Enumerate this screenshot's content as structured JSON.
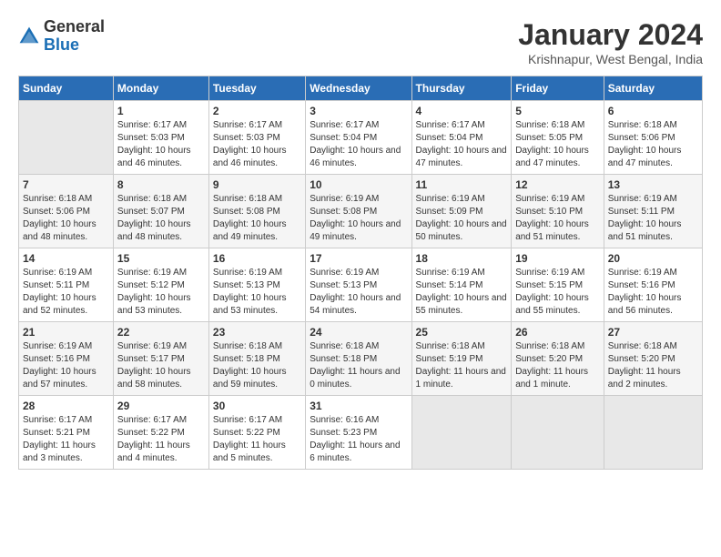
{
  "header": {
    "logo": {
      "general": "General",
      "blue": "Blue"
    },
    "title": "January 2024",
    "location": "Krishnapur, West Bengal, India"
  },
  "columns": [
    "Sunday",
    "Monday",
    "Tuesday",
    "Wednesday",
    "Thursday",
    "Friday",
    "Saturday"
  ],
  "weeks": [
    [
      {
        "day": "",
        "empty": true
      },
      {
        "day": "1",
        "sunrise": "6:17 AM",
        "sunset": "5:03 PM",
        "daylight": "10 hours and 46 minutes."
      },
      {
        "day": "2",
        "sunrise": "6:17 AM",
        "sunset": "5:03 PM",
        "daylight": "10 hours and 46 minutes."
      },
      {
        "day": "3",
        "sunrise": "6:17 AM",
        "sunset": "5:04 PM",
        "daylight": "10 hours and 46 minutes."
      },
      {
        "day": "4",
        "sunrise": "6:17 AM",
        "sunset": "5:04 PM",
        "daylight": "10 hours and 47 minutes."
      },
      {
        "day": "5",
        "sunrise": "6:18 AM",
        "sunset": "5:05 PM",
        "daylight": "10 hours and 47 minutes."
      },
      {
        "day": "6",
        "sunrise": "6:18 AM",
        "sunset": "5:06 PM",
        "daylight": "10 hours and 47 minutes."
      }
    ],
    [
      {
        "day": "7",
        "sunrise": "6:18 AM",
        "sunset": "5:06 PM",
        "daylight": "10 hours and 48 minutes."
      },
      {
        "day": "8",
        "sunrise": "6:18 AM",
        "sunset": "5:07 PM",
        "daylight": "10 hours and 48 minutes."
      },
      {
        "day": "9",
        "sunrise": "6:18 AM",
        "sunset": "5:08 PM",
        "daylight": "10 hours and 49 minutes."
      },
      {
        "day": "10",
        "sunrise": "6:19 AM",
        "sunset": "5:08 PM",
        "daylight": "10 hours and 49 minutes."
      },
      {
        "day": "11",
        "sunrise": "6:19 AM",
        "sunset": "5:09 PM",
        "daylight": "10 hours and 50 minutes."
      },
      {
        "day": "12",
        "sunrise": "6:19 AM",
        "sunset": "5:10 PM",
        "daylight": "10 hours and 51 minutes."
      },
      {
        "day": "13",
        "sunrise": "6:19 AM",
        "sunset": "5:11 PM",
        "daylight": "10 hours and 51 minutes."
      }
    ],
    [
      {
        "day": "14",
        "sunrise": "6:19 AM",
        "sunset": "5:11 PM",
        "daylight": "10 hours and 52 minutes."
      },
      {
        "day": "15",
        "sunrise": "6:19 AM",
        "sunset": "5:12 PM",
        "daylight": "10 hours and 53 minutes."
      },
      {
        "day": "16",
        "sunrise": "6:19 AM",
        "sunset": "5:13 PM",
        "daylight": "10 hours and 53 minutes."
      },
      {
        "day": "17",
        "sunrise": "6:19 AM",
        "sunset": "5:13 PM",
        "daylight": "10 hours and 54 minutes."
      },
      {
        "day": "18",
        "sunrise": "6:19 AM",
        "sunset": "5:14 PM",
        "daylight": "10 hours and 55 minutes."
      },
      {
        "day": "19",
        "sunrise": "6:19 AM",
        "sunset": "5:15 PM",
        "daylight": "10 hours and 55 minutes."
      },
      {
        "day": "20",
        "sunrise": "6:19 AM",
        "sunset": "5:16 PM",
        "daylight": "10 hours and 56 minutes."
      }
    ],
    [
      {
        "day": "21",
        "sunrise": "6:19 AM",
        "sunset": "5:16 PM",
        "daylight": "10 hours and 57 minutes."
      },
      {
        "day": "22",
        "sunrise": "6:19 AM",
        "sunset": "5:17 PM",
        "daylight": "10 hours and 58 minutes."
      },
      {
        "day": "23",
        "sunrise": "6:18 AM",
        "sunset": "5:18 PM",
        "daylight": "10 hours and 59 minutes."
      },
      {
        "day": "24",
        "sunrise": "6:18 AM",
        "sunset": "5:18 PM",
        "daylight": "11 hours and 0 minutes."
      },
      {
        "day": "25",
        "sunrise": "6:18 AM",
        "sunset": "5:19 PM",
        "daylight": "11 hours and 1 minute."
      },
      {
        "day": "26",
        "sunrise": "6:18 AM",
        "sunset": "5:20 PM",
        "daylight": "11 hours and 1 minute."
      },
      {
        "day": "27",
        "sunrise": "6:18 AM",
        "sunset": "5:20 PM",
        "daylight": "11 hours and 2 minutes."
      }
    ],
    [
      {
        "day": "28",
        "sunrise": "6:17 AM",
        "sunset": "5:21 PM",
        "daylight": "11 hours and 3 minutes."
      },
      {
        "day": "29",
        "sunrise": "6:17 AM",
        "sunset": "5:22 PM",
        "daylight": "11 hours and 4 minutes."
      },
      {
        "day": "30",
        "sunrise": "6:17 AM",
        "sunset": "5:22 PM",
        "daylight": "11 hours and 5 minutes."
      },
      {
        "day": "31",
        "sunrise": "6:16 AM",
        "sunset": "5:23 PM",
        "daylight": "11 hours and 6 minutes."
      },
      {
        "day": "",
        "empty": true
      },
      {
        "day": "",
        "empty": true
      },
      {
        "day": "",
        "empty": true
      }
    ]
  ]
}
